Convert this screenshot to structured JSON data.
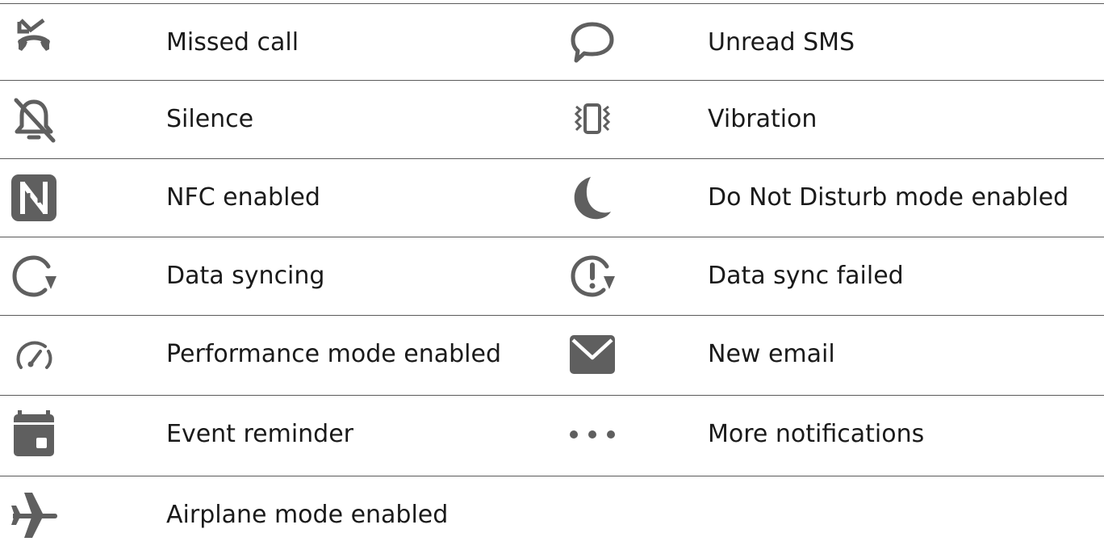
{
  "icon_color": "#5f5f5f",
  "rule_color": "#5a5a5a",
  "rows": [
    {
      "left": {
        "icon": "missed-call-icon",
        "label": "Missed call"
      },
      "right": {
        "icon": "sms-bubble-icon",
        "label": "Unread SMS"
      }
    },
    {
      "left": {
        "icon": "bell-off-icon",
        "label": "Silence"
      },
      "right": {
        "icon": "vibration-icon",
        "label": "Vibration"
      }
    },
    {
      "left": {
        "icon": "nfc-icon",
        "label": "NFC enabled"
      },
      "right": {
        "icon": "moon-icon",
        "label": "Do Not Disturb mode enabled"
      }
    },
    {
      "left": {
        "icon": "sync-icon",
        "label": "Data syncing"
      },
      "right": {
        "icon": "sync-failed-icon",
        "label": "Data sync failed"
      }
    },
    {
      "left": {
        "icon": "speedometer-icon",
        "label": "Performance mode enabled"
      },
      "right": {
        "icon": "envelope-icon",
        "label": "New email"
      }
    },
    {
      "left": {
        "icon": "calendar-icon",
        "label": "Event reminder"
      },
      "right": {
        "icon": "more-dots-icon",
        "label": "More notifications"
      }
    },
    {
      "left": {
        "icon": "airplane-icon",
        "label": "Airplane mode enabled"
      }
    }
  ]
}
